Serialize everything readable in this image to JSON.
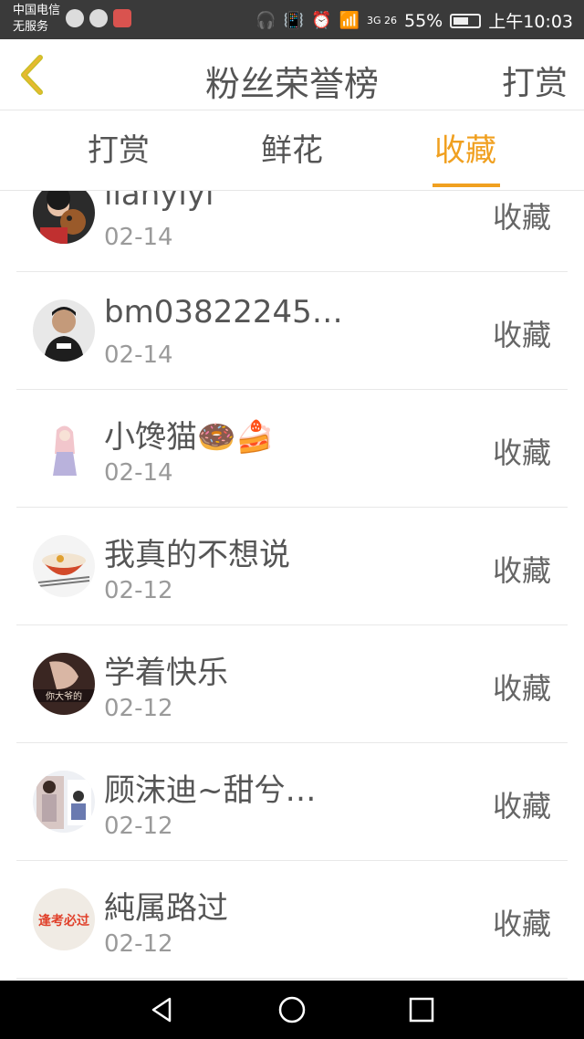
{
  "status_bar": {
    "carrier_line1": "中国电信",
    "carrier_line2": "无服务",
    "network": "3G 26",
    "battery": "55%",
    "time": "上午10:03"
  },
  "header": {
    "title": "粉丝荣誉榜",
    "action_label": "打赏"
  },
  "tabs": [
    {
      "label": "打赏"
    },
    {
      "label": "鲜花"
    },
    {
      "label": "收藏",
      "active": true
    }
  ],
  "list": {
    "items": [
      {
        "name": "lianyiyi",
        "date": "02-14",
        "action": "收藏"
      },
      {
        "name": "bm03822245…",
        "date": "02-14",
        "action": "收藏"
      },
      {
        "name": "小馋猫🍩🍰",
        "date": "02-14",
        "action": "收藏"
      },
      {
        "name": "我真的不想说",
        "date": "02-12",
        "action": "收藏"
      },
      {
        "name": "学着快乐",
        "date": "02-12",
        "action": "收藏"
      },
      {
        "name": "顾沫迪~甜兮…",
        "date": "02-12",
        "action": "收藏"
      },
      {
        "name": "純属路过",
        "date": "02-12",
        "action": "收藏"
      }
    ]
  },
  "avatar_texts": {
    "item5": "你大爷的",
    "item7": "逢考必过"
  },
  "colors": {
    "accent": "#f0a020",
    "text": "#555555",
    "subtext": "#9a9a9a",
    "divider": "#e8e8e8"
  }
}
